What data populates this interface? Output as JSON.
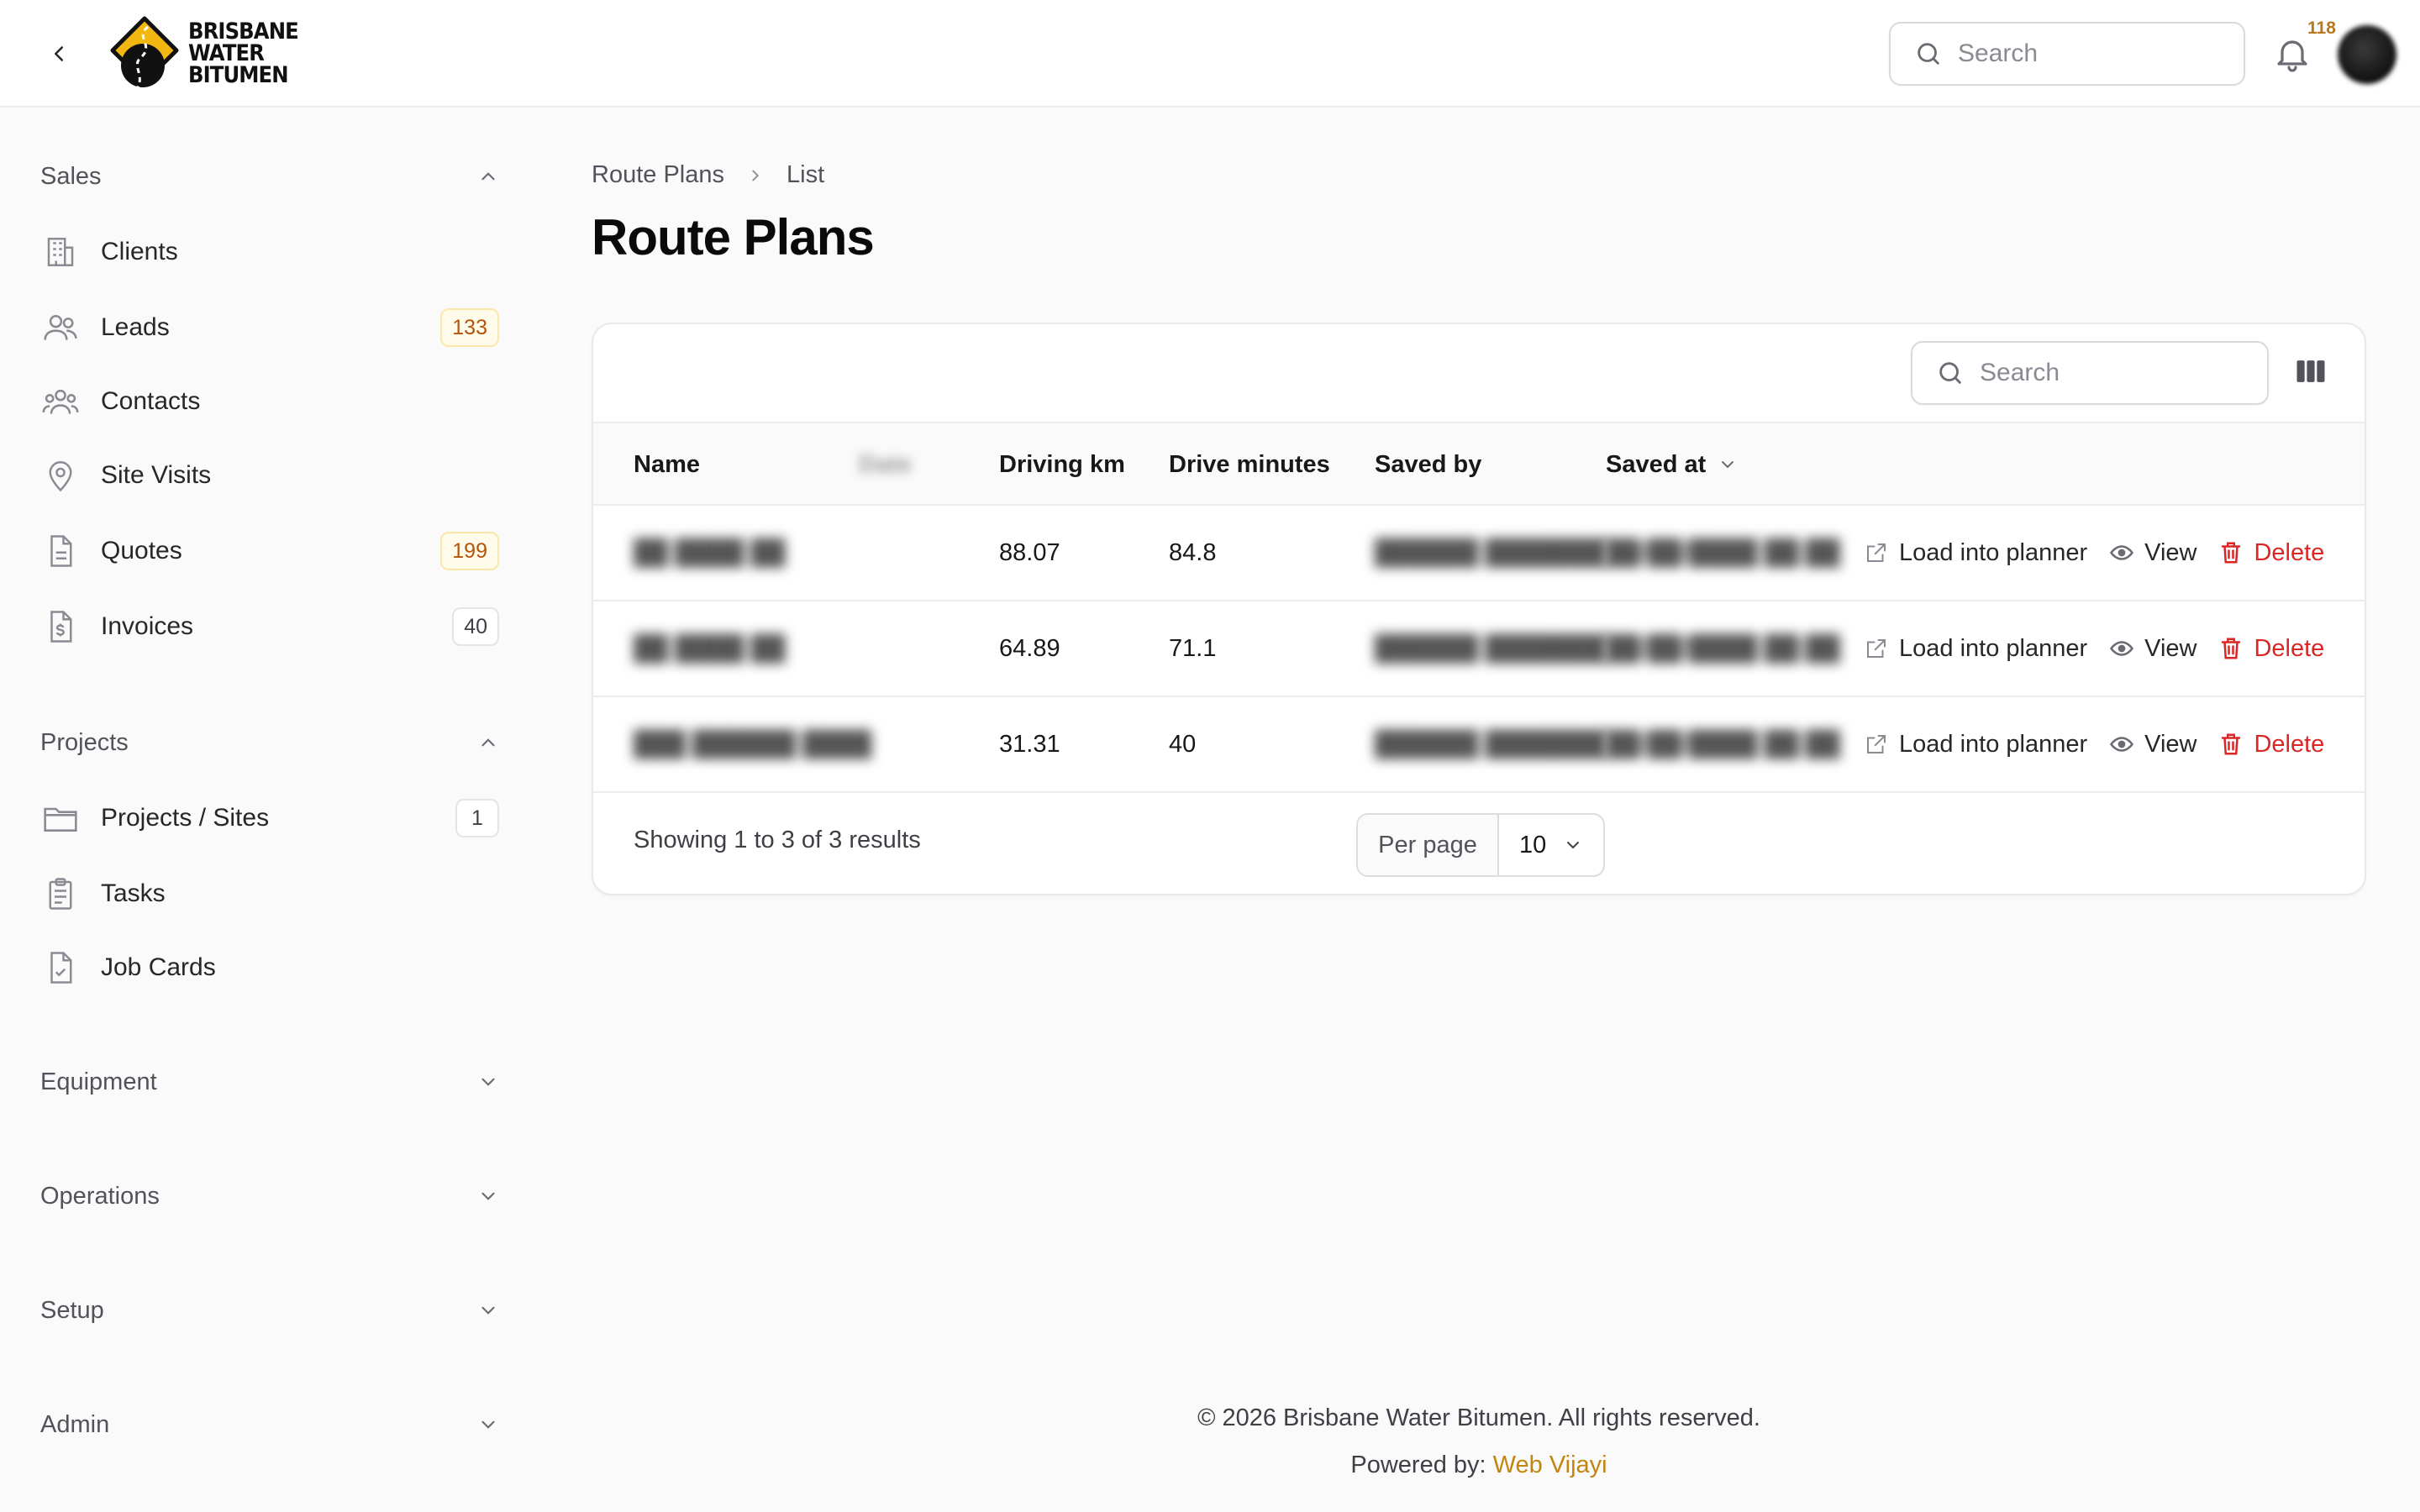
{
  "header": {
    "brand": {
      "line1": "BRISBANE",
      "line2": "WATER",
      "line3": "BITUMEN"
    },
    "search_placeholder": "Search",
    "notification_count": "118"
  },
  "sidebar": {
    "groups": [
      {
        "label": "Sales",
        "expanded": true,
        "items": [
          {
            "label": "Clients",
            "icon": "building-icon",
            "badge": ""
          },
          {
            "label": "Leads",
            "icon": "users-icon",
            "badge": "133"
          },
          {
            "label": "Contacts",
            "icon": "user-group-icon",
            "badge": ""
          },
          {
            "label": "Site Visits",
            "icon": "map-pin-icon",
            "badge": ""
          },
          {
            "label": "Quotes",
            "icon": "document-icon",
            "badge": "199"
          },
          {
            "label": "Invoices",
            "icon": "invoice-dollar-icon",
            "badge": "40"
          }
        ]
      },
      {
        "label": "Projects",
        "expanded": true,
        "items": [
          {
            "label": "Projects / Sites",
            "icon": "folder-icon",
            "badge": "1"
          },
          {
            "label": "Tasks",
            "icon": "clipboard-icon",
            "badge": ""
          },
          {
            "label": "Job Cards",
            "icon": "document-check-icon",
            "badge": ""
          }
        ]
      },
      {
        "label": "Equipment",
        "expanded": false,
        "items": []
      },
      {
        "label": "Operations",
        "expanded": false,
        "items": []
      },
      {
        "label": "Setup",
        "expanded": false,
        "items": []
      },
      {
        "label": "Admin",
        "expanded": false,
        "items": []
      }
    ]
  },
  "breadcrumb": {
    "parent": "Route Plans",
    "current": "List"
  },
  "page_title": "Route Plans",
  "table": {
    "search_placeholder": "Search",
    "columns": {
      "name": "Name",
      "date": "Date",
      "driving_km": "Driving km",
      "drive_minutes": "Drive minutes",
      "saved_by": "Saved by",
      "saved_at": "Saved at"
    },
    "rows": [
      {
        "name": "██ ████ ██",
        "driving_km": "88.07",
        "drive_minutes": "84.8",
        "saved_by": "██████ ███████",
        "saved_at": "██/██/████ ██:██"
      },
      {
        "name": "██ ████ ██",
        "driving_km": "64.89",
        "drive_minutes": "71.1",
        "saved_by": "██████ ███████",
        "saved_at": "██/██/████ ██:██"
      },
      {
        "name": "███ ██████ ████",
        "driving_km": "31.31",
        "drive_minutes": "40",
        "saved_by": "██████ ███████",
        "saved_at": "██/██/████ ██:██"
      }
    ],
    "actions": {
      "load": "Load into planner",
      "view": "View",
      "delete": "Delete"
    },
    "summary": "Showing 1 to 3 of 3 results",
    "per_page_label": "Per page",
    "per_page_value": "10"
  },
  "footer": {
    "copyright": "© 2026 Brisbane Water Bitumen. All rights reserved.",
    "powered_label": "Powered by:",
    "powered_link": "Web Vijayi"
  },
  "colors": {
    "accent": "#c2860f",
    "danger": "#dc2626",
    "warn_badge_bg": "#fffbeb"
  }
}
